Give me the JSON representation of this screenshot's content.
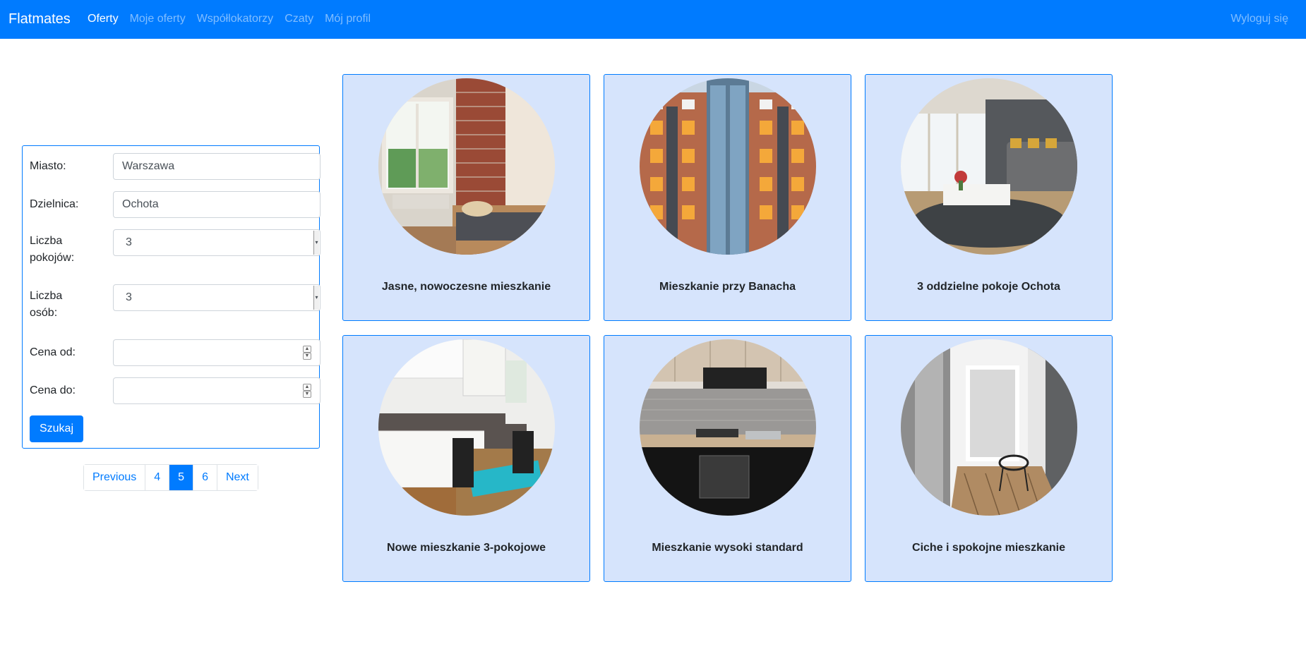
{
  "navbar": {
    "brand": "Flatmates",
    "links": [
      "Oferty",
      "Moje oferty",
      "Współlokatorzy",
      "Czaty",
      "Mój profil"
    ],
    "active_link": "Oferty",
    "logout": "Wyloguj się"
  },
  "search": {
    "city_label": "Miasto:",
    "city_value": "Warszawa",
    "district_label": "Dzielnica:",
    "district_value": "Ochota",
    "rooms_label": "Liczba pokojów:",
    "rooms_value": "3",
    "people_label": "Liczba osób:",
    "people_value": "3",
    "price_from_label": "Cena od:",
    "price_from_value": "",
    "price_to_label": "Cena do:",
    "price_to_value": "",
    "submit_label": "Szukaj"
  },
  "pagination": {
    "previous": "Previous",
    "pages": [
      "4",
      "5",
      "6"
    ],
    "current": "5",
    "next": "Next"
  },
  "offers": [
    {
      "title": "Jasne, nowoczesne mieszkanie",
      "image": "bedroom-photo-icon"
    },
    {
      "title": "Mieszkanie przy Banacha",
      "image": "building-photo-icon"
    },
    {
      "title": "3 oddzielne pokoje Ochota",
      "image": "living-room-photo-icon"
    },
    {
      "title": "Nowe mieszkanie 3-pokojowe",
      "image": "kitchen-photo-icon"
    },
    {
      "title": "Mieszkanie wysoki standard",
      "image": "kitchen-photo-icon"
    },
    {
      "title": "Ciche i spokojne mieszkanie",
      "image": "hallway-photo-icon"
    }
  ],
  "colors": {
    "primary": "#007bff",
    "card_bg": "#d6e4fc"
  }
}
